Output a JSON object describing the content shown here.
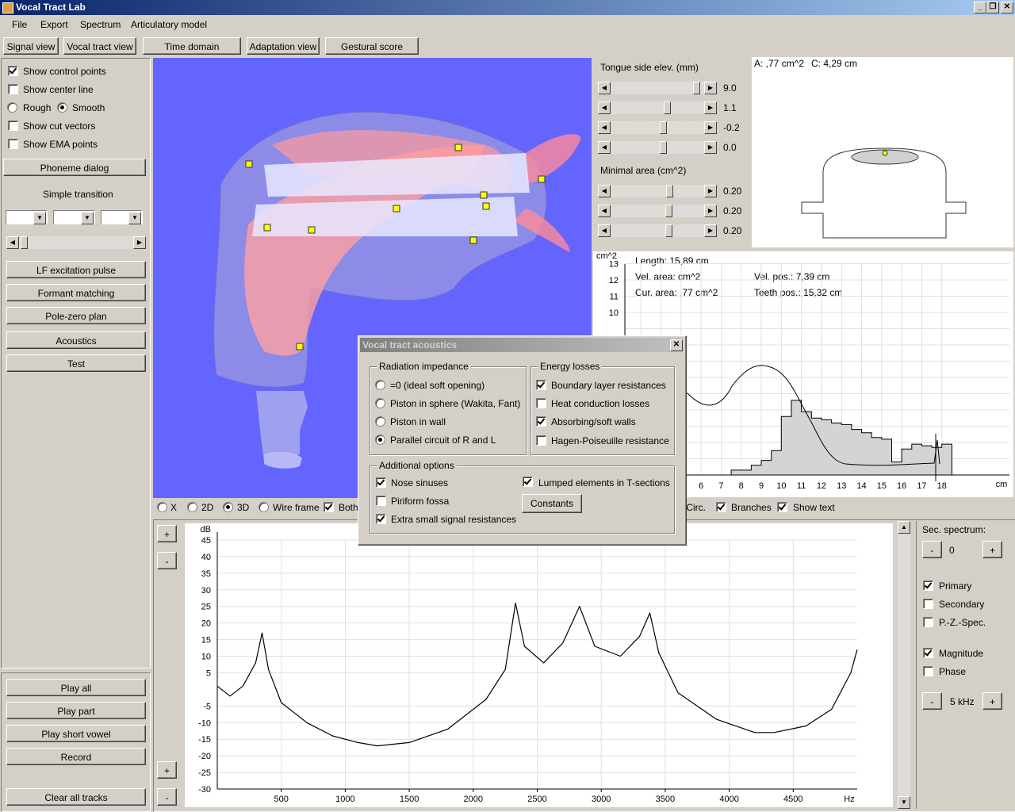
{
  "window": {
    "title": "Vocal Tract Lab"
  },
  "menu": [
    "File",
    "Export",
    "Spectrum",
    "Articulatory model"
  ],
  "tabs": [
    "Signal view",
    "Vocal tract view",
    "Time domain simulation",
    "Adaptation view",
    "Gestural score"
  ],
  "left": {
    "show_control_points": "Show control points",
    "show_center_line": "Show center line",
    "rough": "Rough",
    "smooth": "Smooth",
    "show_cut_vectors": "Show cut vectors",
    "show_ema_points": "Show EMA points",
    "phoneme_dialog": "Phoneme dialog",
    "simple_transition": "Simple transition",
    "lf_excitation": "LF excitation pulse",
    "formant_matching": "Formant matching",
    "pole_zero": "Pole-zero plan",
    "acoustics": "Acoustics",
    "test": "Test",
    "play_all": "Play all",
    "play_part": "Play part",
    "play_short_vowel": "Play short vowel",
    "record": "Record",
    "clear_all_tracks": "Clear all tracks"
  },
  "view3d_options": {
    "x": "X",
    "d2": "2D",
    "d3": "3D",
    "wire": "Wire frame",
    "both": "Both"
  },
  "params": {
    "title": "Tongue side elev. (mm)",
    "values": [
      "9.0",
      "1.1",
      "-0.2",
      "0.0"
    ],
    "min_area_title": "Minimal area (cm^2)",
    "min_area_values": [
      "0.20",
      "0.20",
      "0.20"
    ]
  },
  "cross_section": {
    "area": "A: ,77 cm^2",
    "circ": "C: 4,29 cm"
  },
  "area_plot": {
    "ylabel": "cm^2",
    "length": "Length: 15,89 cm",
    "vel_area": "Vel. area:  cm^2",
    "vel_pos": "Vel. pos.: 7,39 cm",
    "cur_area": "Cur. area: ,77 cm^2",
    "teeth_pos": "Teeth pos.: 15,32 cm",
    "yticks": [
      "13",
      "12",
      "11",
      "10"
    ],
    "xticks": [
      "3",
      "4",
      "5",
      "6",
      "7",
      "8",
      "9",
      "10",
      "11",
      "12",
      "13",
      "14",
      "15",
      "16",
      "17",
      "18"
    ],
    "xunit": "cm",
    "opt_circ": "/Circ.",
    "opt_branches": "Branches",
    "opt_showtext": "Show text"
  },
  "dialog": {
    "title": "Vocal tract acoustics",
    "radiation_title": "Radiation impedance",
    "radiation": [
      "=0 (ideal soft opening)",
      "Piston in sphere (Wakita, Fant)",
      "Piston in wall",
      "Parallel circuit of R and L"
    ],
    "energy_title": "Energy losses",
    "energy": [
      "Boundary layer resistances",
      "Heat conduction losses",
      "Absorbing/soft walls",
      "Hagen-Poiseuille resistance"
    ],
    "energy_checked": [
      true,
      false,
      true,
      false
    ],
    "additional_title": "Additional options",
    "nose_sinuses": "Nose sinuses",
    "piriform_fossa": "Piriform fossa",
    "extra_small": "Extra small signal resistances",
    "lumped": "Lumped elements in T-sections",
    "constants": "Constants"
  },
  "spectrum": {
    "ylabel": "dB",
    "xlabel": "Hz",
    "yticks": [
      "45",
      "40",
      "35",
      "30",
      "25",
      "20",
      "15",
      "10",
      "5",
      "-5",
      "-10",
      "-15",
      "-20",
      "-25",
      "-30"
    ],
    "xticks": [
      "500",
      "1000",
      "1500",
      "2000",
      "2500",
      "3000",
      "3500",
      "4000",
      "4500"
    ]
  },
  "right": {
    "sec_spectrum": "Sec. spectrum:",
    "sec_value": "0",
    "primary": "Primary",
    "secondary": "Secondary",
    "pz_spec": "P.-Z.-Spec.",
    "magnitude": "Magnitude",
    "phase": "Phase",
    "range": "5 kHz",
    "minus": "-",
    "plus": "+"
  },
  "chart_data": [
    {
      "type": "line",
      "ylabel": "dB",
      "xlabel": "Hz",
      "xlim": [
        0,
        5000
      ],
      "ylim": [
        -30,
        45
      ],
      "x": [
        0,
        100,
        200,
        300,
        350,
        400,
        500,
        700,
        900,
        1100,
        1250,
        1500,
        1800,
        2100,
        2250,
        2330,
        2400,
        2550,
        2700,
        2830,
        2950,
        3150,
        3300,
        3380,
        3450,
        3600,
        3900,
        4200,
        4350,
        4600,
        4800,
        4950,
        5000
      ],
      "y": [
        1,
        -2,
        1,
        8,
        17,
        6,
        -4,
        -10,
        -14,
        -16,
        -17,
        -16,
        -12,
        -3,
        6,
        26,
        13,
        8,
        14,
        25,
        13,
        10,
        16,
        23,
        11,
        -1,
        -9,
        -13,
        -13,
        -11,
        -6,
        5,
        12
      ]
    },
    {
      "type": "area",
      "ylabel": "cm^2",
      "xlabel": "cm",
      "x": [
        7.5,
        8.5,
        9.0,
        9.5,
        10.0,
        10.5,
        11.0,
        11.5,
        12.0,
        12.5,
        13.0,
        13.5,
        14.0,
        14.5,
        15.0,
        15.5,
        16.0,
        16.5,
        17.0,
        17.5,
        18.0
      ],
      "values": [
        0.3,
        0.6,
        0.9,
        1.5,
        3.6,
        4.6,
        3.9,
        3.5,
        3.4,
        3.2,
        3.1,
        2.8,
        2.6,
        2.3,
        2.2,
        0.8,
        1.6,
        1.9,
        1.8,
        1.7,
        1.9
      ]
    }
  ]
}
